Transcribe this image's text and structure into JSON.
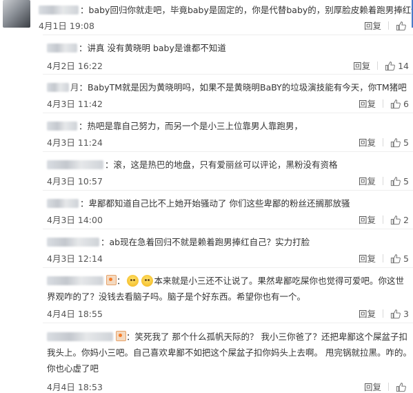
{
  "comments": [
    {
      "name_suffix": "",
      "text": "baby回归你就走吧，毕竟baby是固定的，你是代替baby的，别厚脸皮赖着跑男捧红你",
      "date": "4月1日 19:08",
      "reply": "回复",
      "likes": ""
    },
    {
      "name_suffix": "",
      "text": "讲真 没有黄晓明 baby是谁都不知道",
      "date": "4月2日 16:22",
      "reply": "回复",
      "likes": "14"
    },
    {
      "name_suffix": "月",
      "text": "BabyTM就是因为黄晓明吗，如果不是黄晓明BaBY的垃圾演技能有今天，你TM猪吧",
      "date": "4月3日 11:42",
      "reply": "回复",
      "likes": "6"
    },
    {
      "name_suffix": "",
      "text": "热吧是靠自己努力，而另一个是小三上位靠男人靠跑男，",
      "date": "4月3日 11:24",
      "reply": "回复",
      "likes": "5"
    },
    {
      "name_suffix": "",
      "text": "滚，这是热巴的地盘，只有爱丽丝可以评论，黑粉没有资格",
      "date": "4月3日 10:57",
      "reply": "回复",
      "likes": "5"
    },
    {
      "name_suffix": "",
      "text": "卑鄙都知道自己比不上她开始骚动了 你们这些卑鄙的粉丝还搁那放骚",
      "date": "4月3日 14:00",
      "reply": "回复",
      "likes": "2"
    },
    {
      "name_suffix": "",
      "text": "ab现在急着回归不就是赖着跑男捧红自己？实力打脸",
      "date": "4月3日 12:14",
      "reply": "回复",
      "likes": "5"
    },
    {
      "name_suffix": "",
      "text": "本来就是小三还不让说了。果然卑鄙吃屎你也觉得可爱吧。你这世界观咋的了？没钱去看脑子吗。脑子是个好东西。希望你也有一个。",
      "date": "4月4日 18:55",
      "reply": "回复",
      "likes": "3"
    },
    {
      "name_suffix": "",
      "text": "笑死我了 那个什么孤帆天际的？ 我小三你爸了？还把卑鄙这个屎盆子扣我头上。你妈小三吧。自己喜欢卑鄙不如把这个屎盆子扣你妈头上去啊。 甩完锅就拉黑。咋的。你也心虚了吧",
      "date": "4月4日 18:53",
      "reply": "回复",
      "likes": ""
    }
  ],
  "colors": {
    "text": "#333333",
    "meta": "#555555",
    "divider": "#eeeeee"
  },
  "icons": {
    "like": "thumbs-up-icon",
    "vip": "vip-badge-icon",
    "emoji": "emoji-face-icon"
  }
}
